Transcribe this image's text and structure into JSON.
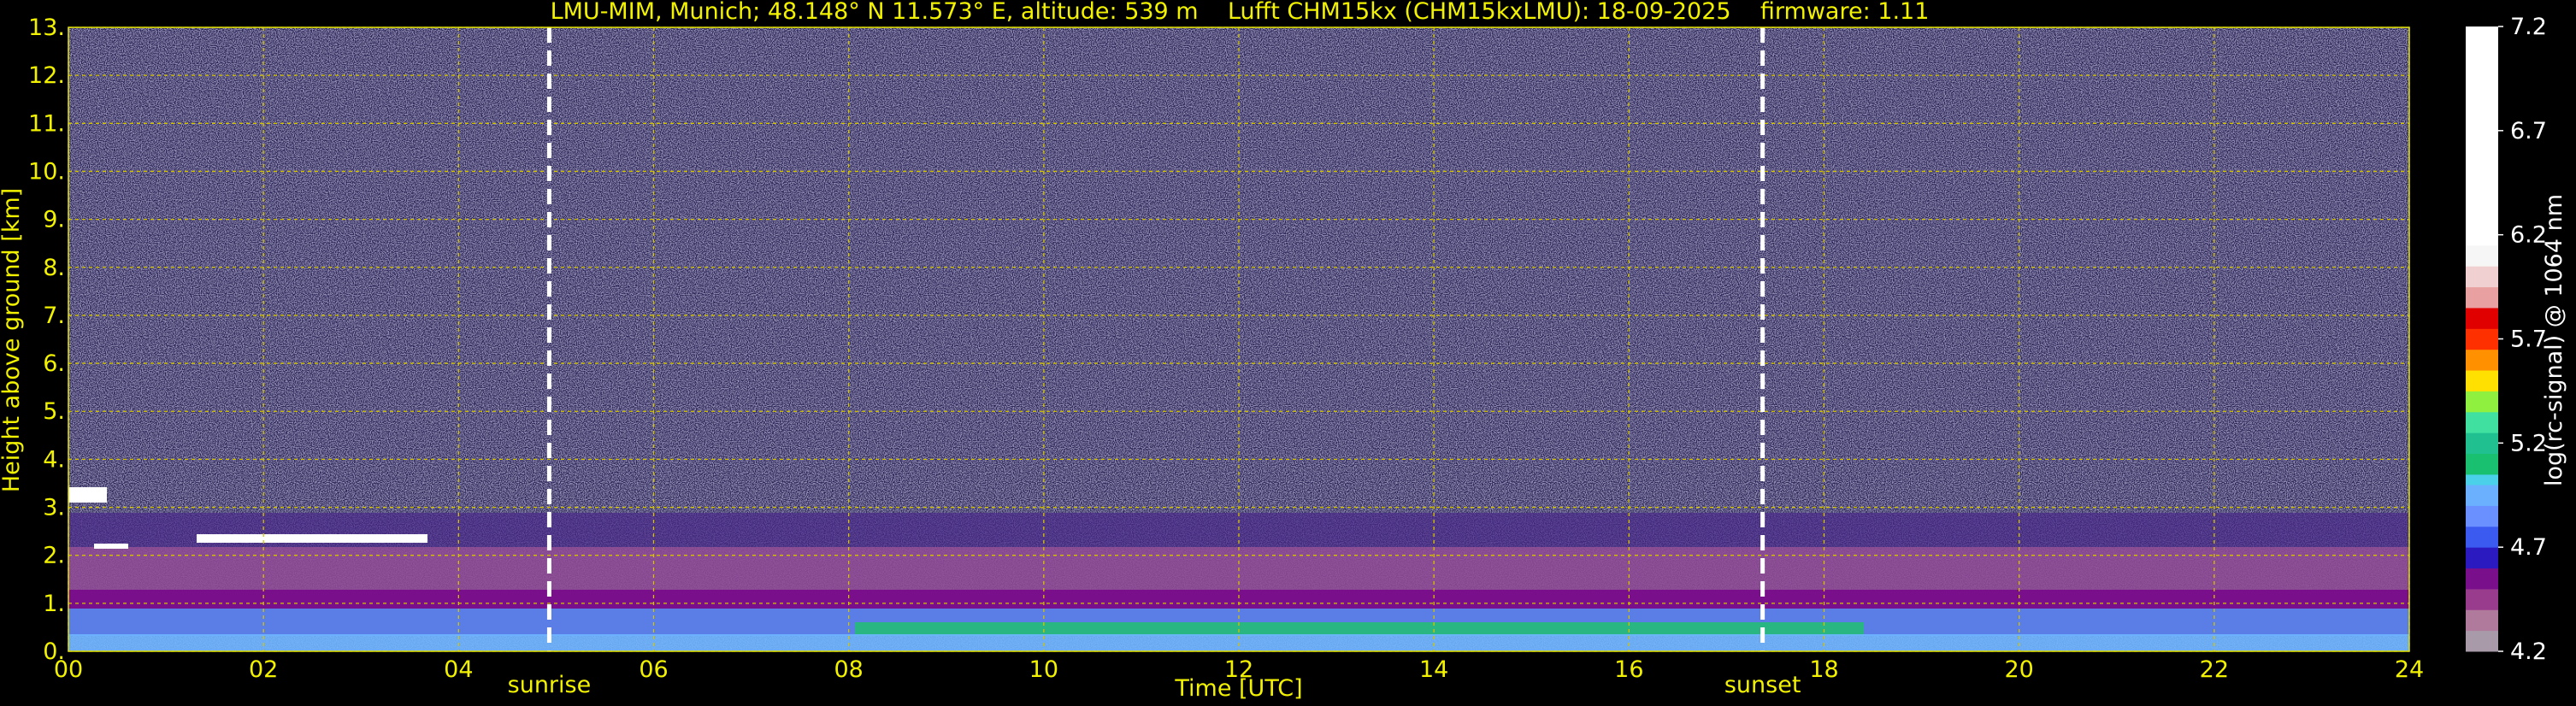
{
  "chart_data": {
    "type": "heatmap",
    "title": "LMU-MIM, Munich; 48.148° N 11.573° E, altitude: 539 m    Lufft CHM15kx (CHM15kxLMU): 18-09-2025    firmware: 1.11",
    "xlabel": "Time [UTC]",
    "ylabel": "Height above ground [km]",
    "xlim": [
      0,
      24
    ],
    "ylim": [
      0,
      13
    ],
    "x_tick_labels": [
      "00",
      "02",
      "04",
      "06",
      "08",
      "10",
      "12",
      "14",
      "16",
      "18",
      "20",
      "22",
      "24"
    ],
    "y_tick_labels": [
      "0.",
      "1.",
      "2.",
      "3.",
      "4.",
      "5.",
      "6.",
      "7.",
      "8.",
      "9.",
      "10.",
      "11.",
      "12.",
      "13."
    ],
    "grid": true,
    "colorbar": {
      "label": "log(rc-signal) @ 1064 nm",
      "range": [
        4.2,
        7.2
      ],
      "tick_labels": [
        "4.2",
        "4.7",
        "5.2",
        "5.7",
        "6.2",
        "6.7",
        "7.2"
      ]
    },
    "annotations": [
      {
        "label": "sunrise",
        "x": 4.93
      },
      {
        "label": "sunset",
        "x": 17.37
      }
    ]
  },
  "colors": {
    "axis_text": "#f2f200",
    "grid": "#d4c400",
    "event_line": "#ffffff",
    "colorbar_text": "#ffffff"
  }
}
